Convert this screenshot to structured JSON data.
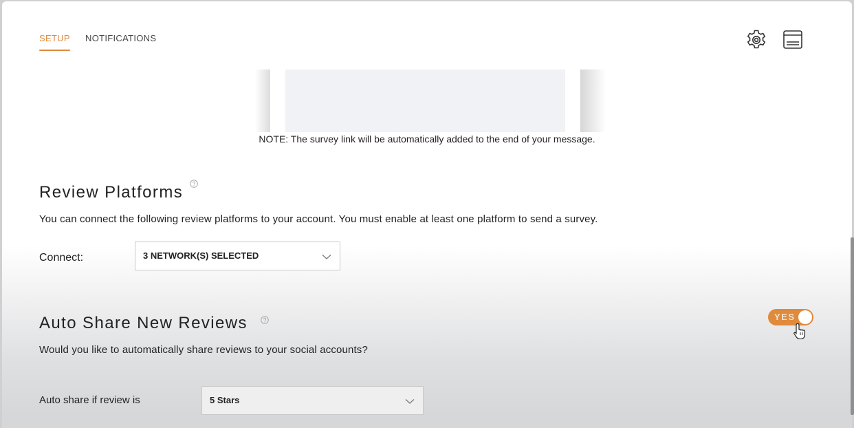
{
  "tabs": [
    {
      "label": "SETUP",
      "active": true
    },
    {
      "label": "NOTIFICATIONS",
      "active": false
    }
  ],
  "header_icons": [
    "gear-icon",
    "window-icon"
  ],
  "note": "NOTE: The survey link will be automatically added to the end of your message.",
  "review_platforms": {
    "title": "Review Platforms",
    "description": "You can connect the following review platforms to your account. You must enable at least one platform to send a survey.",
    "connect_label": "Connect:",
    "connect_value": "3 NETWORK(S) SELECTED"
  },
  "auto_share": {
    "title": "Auto Share New Reviews",
    "description": "Would you like to automatically share reviews to your social accounts?",
    "toggle_label": "YES",
    "toggle_on": true,
    "rule_label": "Auto share if review is",
    "rule_value": "5 Stars"
  },
  "colors": {
    "accent": "#e0893a",
    "toggle": "#e08a3c",
    "preview_box": "#f1f2f6"
  }
}
